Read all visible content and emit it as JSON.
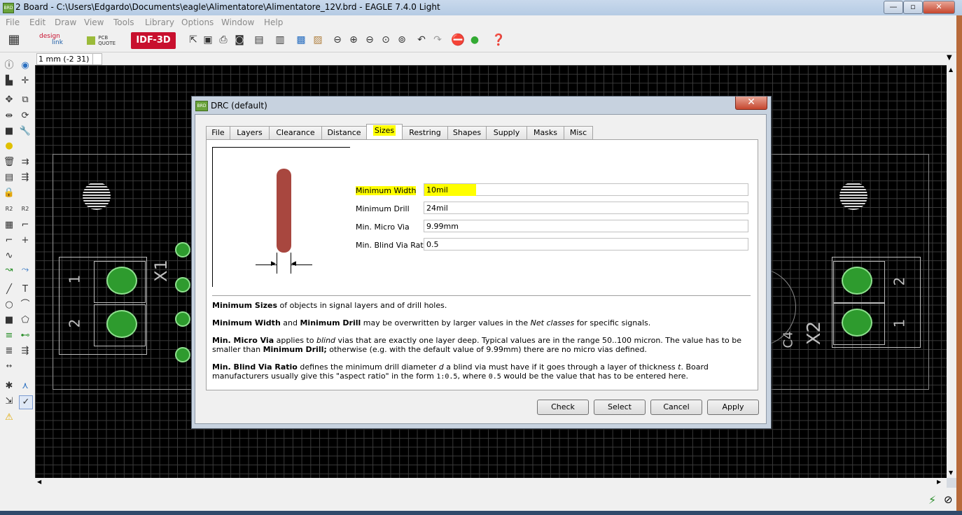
{
  "window": {
    "icon_text": "BRD",
    "title": "2 Board - C:\\Users\\Edgardo\\Documents\\eagle\\Alimentatore\\Alimentatore_12V.brd - EAGLE 7.4.0 Light",
    "minimize": "—",
    "maximize": "▫",
    "close": "✕"
  },
  "menu": [
    "File",
    "Edit",
    "Draw",
    "View",
    "Tools",
    "Library",
    "Options",
    "Window",
    "Help"
  ],
  "toolbar": {
    "designlink_line1": "design",
    "designlink_line2": "link",
    "pcbquote_line1": "PCB",
    "pcbquote_line2": "QUOTE",
    "idf3d": "IDF-3D"
  },
  "coord": "1 mm (-2 31)",
  "board": {
    "x1_label": "X1",
    "x2_label": "X2",
    "c4_label": "C4",
    "pin1": "1",
    "pin2": "2"
  },
  "dialog": {
    "icon_text": "BRD",
    "title": "DRC (default)",
    "close": "✕",
    "tabs": [
      "File",
      "Layers",
      "Clearance",
      "Distance",
      "Sizes",
      "Restring",
      "Shapes",
      "Supply",
      "Masks",
      "Misc"
    ],
    "active_tab": "Sizes",
    "fields": [
      {
        "label": "Minimum Width",
        "value": "10mil"
      },
      {
        "label": "Minimum Drill",
        "value": "24mil"
      },
      {
        "label": "Min. Micro Via",
        "value": "9.99mm"
      },
      {
        "label": "Min. Blind Via Ratio",
        "value": "0.5"
      }
    ],
    "help": {
      "p1_b": "Minimum Sizes",
      "p1_t": " of objects in signal layers and of drill holes.",
      "p2_b1": "Minimum Width",
      "p2_t1": " and ",
      "p2_b2": "Minimum Drill",
      "p2_t2": " may be overwritten by larger values in the ",
      "p2_i": "Net classes",
      "p2_t3": " for specific signals.",
      "p3_b1": "Min. Micro Via",
      "p3_t1": " applies to ",
      "p3_i": "blind",
      "p3_t2": " vias that are exactly one layer deep. Typical values are in the range 50..100 micron. The value has to be smaller than ",
      "p3_b2": "Minimum Drill;",
      "p3_t3": " otherwise (e.g. with the default value of 9.99mm) there are no micro vias defined.",
      "p4_b": "Min. Blind Via Ratio",
      "p4_t1": " defines the minimum drill diameter ",
      "p4_i1": "d",
      "p4_t2": " a blind via must have if it goes through a layer of thickness ",
      "p4_i2": "t",
      "p4_t3": ". Board manufacturers usually give this \"aspect ratio\" in the form ",
      "p4_m1": "1:0.5",
      "p4_t4": ", where ",
      "p4_m2": "0.5",
      "p4_t5": " would be the value that has to be entered here."
    },
    "buttons": {
      "check": "Check",
      "select": "Select",
      "cancel": "Cancel",
      "apply": "Apply"
    }
  }
}
